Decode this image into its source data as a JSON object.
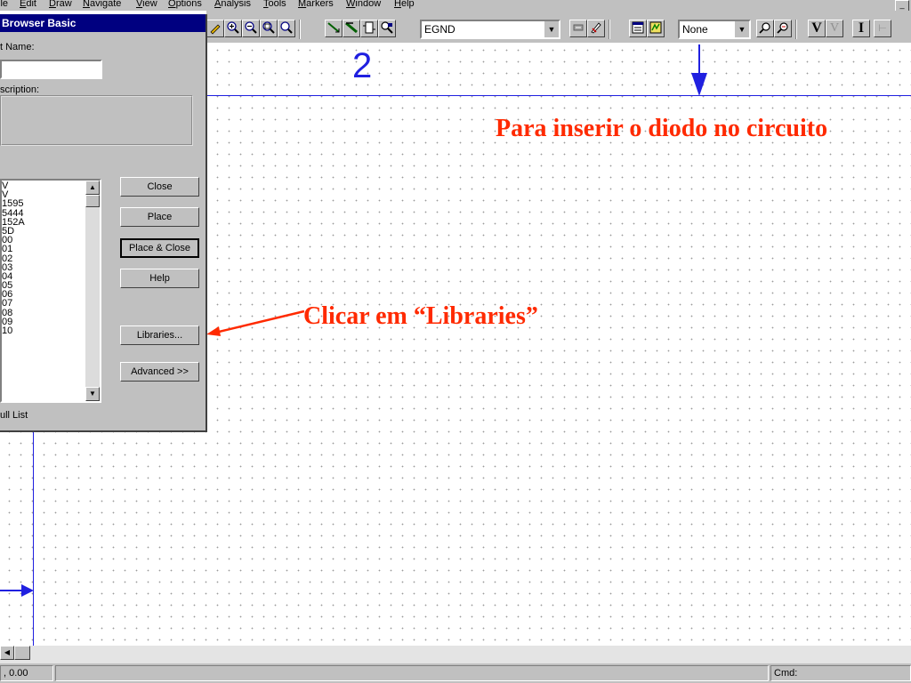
{
  "menu": {
    "items": [
      {
        "pre": "",
        "u": "",
        "post": "ile"
      },
      {
        "pre": "",
        "u": "E",
        "post": "dit"
      },
      {
        "pre": "",
        "u": "D",
        "post": "raw"
      },
      {
        "pre": "",
        "u": "N",
        "post": "avigate"
      },
      {
        "pre": "",
        "u": "V",
        "post": "iew"
      },
      {
        "pre": "",
        "u": "O",
        "post": "ptions"
      },
      {
        "pre": "",
        "u": "A",
        "post": "nalysis"
      },
      {
        "pre": "",
        "u": "T",
        "post": "ools"
      },
      {
        "pre": "",
        "u": "M",
        "post": "arkers"
      },
      {
        "pre": "",
        "u": "W",
        "post": "indow"
      },
      {
        "pre": "",
        "u": "H",
        "post": "elp"
      }
    ]
  },
  "toolbar": {
    "part_combo_value": "EGND",
    "style_combo_value": "None",
    "voltage_label": "V",
    "current_label": "I"
  },
  "dialog": {
    "title": "Browser Basic",
    "part_name_label": "t Name:",
    "description_label": "scription:",
    "full_list_label": "ull List",
    "parts": [
      "V",
      "V",
      "1595",
      "5444",
      "152A",
      "5D",
      "00",
      "01",
      "02",
      "03",
      "04",
      "05",
      "06",
      "07",
      "08",
      "09",
      "10"
    ],
    "buttons": {
      "close": "Close",
      "place": "Place",
      "place_close": "Place & Close",
      "help": "Help",
      "libraries": "Libraries...",
      "advanced": "Advanced >>"
    }
  },
  "canvas": {
    "step_number": "2",
    "annotation_top": "Para inserir o diodo no circuito",
    "annotation_libraries": "Clicar em “Libraries”"
  },
  "status": {
    "coords": ", 0.00",
    "cmd": "Cmd:"
  },
  "colors": {
    "wire_blue": "#2020e0",
    "annotation_red": "#ff2a00",
    "titlebar": "#000080"
  }
}
